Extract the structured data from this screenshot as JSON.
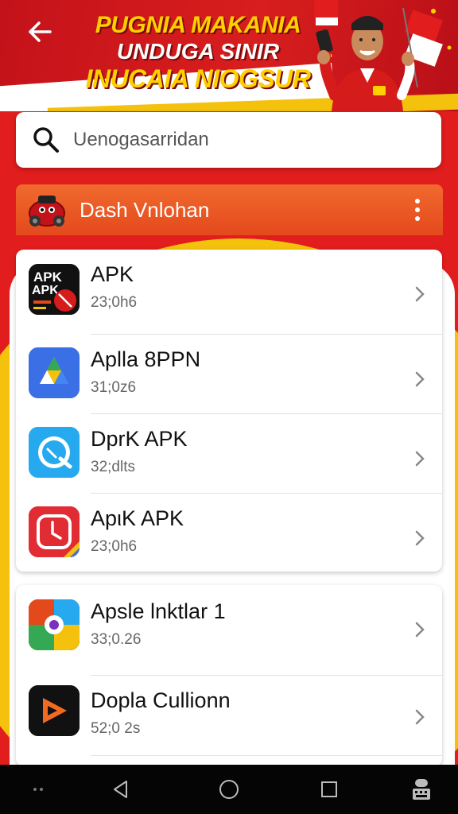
{
  "banner": {
    "line1": "PUGNIA MAKANIA",
    "line2": "UNDUGA SINIR",
    "line3": "INUCAIA NIOGSUR"
  },
  "search": {
    "placeholder": "Uenogasarridan"
  },
  "section": {
    "title": "Dash Vnlohan"
  },
  "apps": [
    {
      "name": "APK",
      "size": "23;0h6",
      "icon": "apk-red-icon",
      "icon_text": "APK"
    },
    {
      "name": "Aplla 8PPN",
      "size": "31;0z6",
      "icon": "drive-triangle-icon"
    },
    {
      "name": "DprK APK",
      "size": "32;dlts",
      "icon": "blue-chat-icon"
    },
    {
      "name": "ApιK APK",
      "size": "23;0h6",
      "icon": "red-clock-icon"
    }
  ],
  "apps_more": [
    {
      "name": "Apsle lnktlar 1",
      "size": "33;0.26",
      "icon": "game-collage-icon"
    },
    {
      "name": "Dopla Cullionn",
      "size": "52;0 2s",
      "icon": "orange-play-icon"
    }
  ],
  "colors": {
    "brand_red": "#e11d1d",
    "header_orange": "#e8531f",
    "accent_yellow": "#f4c20d"
  }
}
